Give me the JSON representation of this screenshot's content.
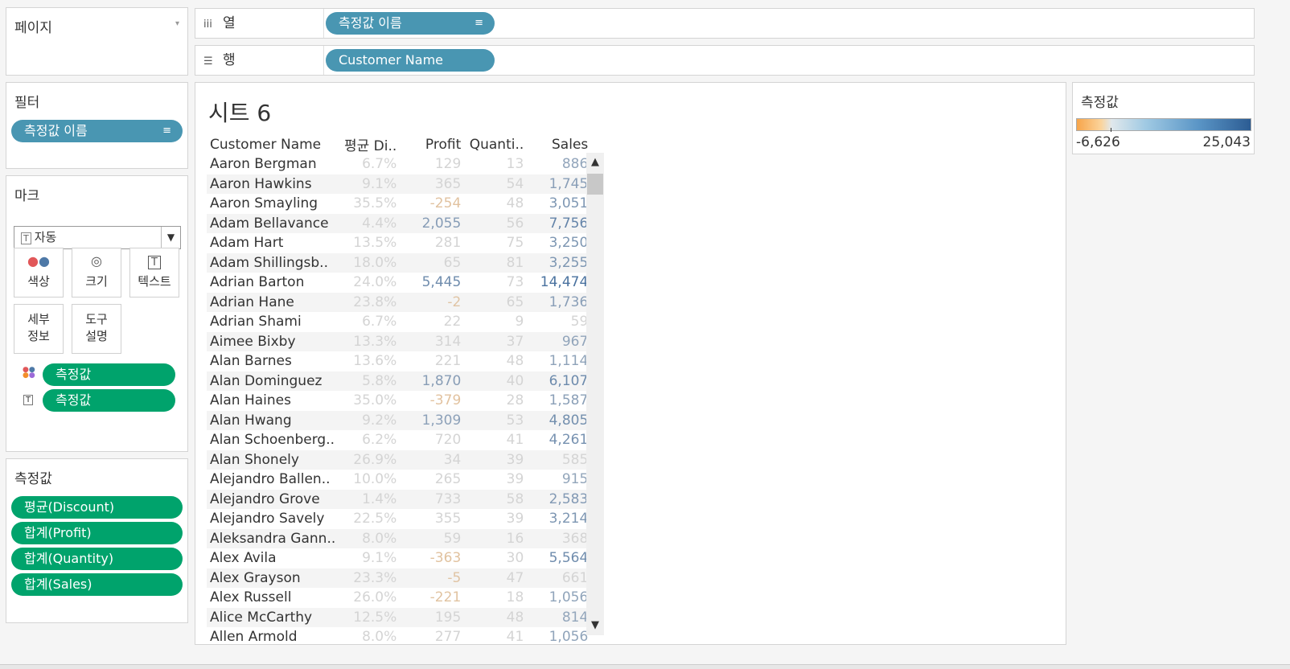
{
  "pages": {
    "title": "페이지"
  },
  "shelves": {
    "columns": {
      "label": "열",
      "pill": "측정값 이름"
    },
    "rows": {
      "label": "행",
      "pill": "Customer Name"
    }
  },
  "filters": {
    "title": "필터",
    "pill": "측정값 이름"
  },
  "marks": {
    "title": "마크",
    "type_dropdown": "자동",
    "buttons": {
      "color": "색상",
      "size": "크기",
      "text": "텍스트",
      "detail_line1": "세부",
      "detail_line2": "정보",
      "tooltip_line1": "도구",
      "tooltip_line2": "설명"
    },
    "fields": [
      "측정값",
      "측정값"
    ]
  },
  "measure_values": {
    "title": "측정값",
    "items": [
      "평균(Discount)",
      "합계(Profit)",
      "합계(Quantity)",
      "합계(Sales)"
    ]
  },
  "view": {
    "title": "시트 6",
    "headers": [
      "Customer Name",
      "평균 Di..",
      "Profit",
      "Quanti..",
      "Sales"
    ],
    "rows": [
      {
        "name": "Aaron Bergman",
        "discount": "6.7%",
        "profit": "129",
        "quantity": "13",
        "sales": "886"
      },
      {
        "name": "Aaron Hawkins",
        "discount": "9.1%",
        "profit": "365",
        "quantity": "54",
        "sales": "1,745"
      },
      {
        "name": "Aaron Smayling",
        "discount": "35.5%",
        "profit": "-254",
        "quantity": "48",
        "sales": "3,051"
      },
      {
        "name": "Adam Bellavance",
        "discount": "4.4%",
        "profit": "2,055",
        "quantity": "56",
        "sales": "7,756"
      },
      {
        "name": "Adam Hart",
        "discount": "13.5%",
        "profit": "281",
        "quantity": "75",
        "sales": "3,250"
      },
      {
        "name": "Adam Shillingsb..",
        "discount": "18.0%",
        "profit": "65",
        "quantity": "81",
        "sales": "3,255"
      },
      {
        "name": "Adrian Barton",
        "discount": "24.0%",
        "profit": "5,445",
        "quantity": "73",
        "sales": "14,474"
      },
      {
        "name": "Adrian Hane",
        "discount": "23.8%",
        "profit": "-2",
        "quantity": "65",
        "sales": "1,736"
      },
      {
        "name": "Adrian Shami",
        "discount": "6.7%",
        "profit": "22",
        "quantity": "9",
        "sales": "59"
      },
      {
        "name": "Aimee Bixby",
        "discount": "13.3%",
        "profit": "314",
        "quantity": "37",
        "sales": "967"
      },
      {
        "name": "Alan Barnes",
        "discount": "13.6%",
        "profit": "221",
        "quantity": "48",
        "sales": "1,114"
      },
      {
        "name": "Alan Dominguez",
        "discount": "5.8%",
        "profit": "1,870",
        "quantity": "40",
        "sales": "6,107"
      },
      {
        "name": "Alan Haines",
        "discount": "35.0%",
        "profit": "-379",
        "quantity": "28",
        "sales": "1,587"
      },
      {
        "name": "Alan Hwang",
        "discount": "9.2%",
        "profit": "1,309",
        "quantity": "53",
        "sales": "4,805"
      },
      {
        "name": "Alan Schoenberg..",
        "discount": "6.2%",
        "profit": "720",
        "quantity": "41",
        "sales": "4,261"
      },
      {
        "name": "Alan Shonely",
        "discount": "26.9%",
        "profit": "34",
        "quantity": "39",
        "sales": "585"
      },
      {
        "name": "Alejandro Ballen..",
        "discount": "10.0%",
        "profit": "265",
        "quantity": "39",
        "sales": "915"
      },
      {
        "name": "Alejandro Grove",
        "discount": "1.4%",
        "profit": "733",
        "quantity": "58",
        "sales": "2,583"
      },
      {
        "name": "Alejandro Savely",
        "discount": "22.5%",
        "profit": "355",
        "quantity": "39",
        "sales": "3,214"
      },
      {
        "name": "Aleksandra Gann..",
        "discount": "8.0%",
        "profit": "59",
        "quantity": "16",
        "sales": "368"
      },
      {
        "name": "Alex Avila",
        "discount": "9.1%",
        "profit": "-363",
        "quantity": "30",
        "sales": "5,564"
      },
      {
        "name": "Alex Grayson",
        "discount": "23.3%",
        "profit": "-5",
        "quantity": "47",
        "sales": "661"
      },
      {
        "name": "Alex Russell",
        "discount": "26.0%",
        "profit": "-221",
        "quantity": "18",
        "sales": "1,056"
      },
      {
        "name": "Alice McCarthy",
        "discount": "12.5%",
        "profit": "195",
        "quantity": "48",
        "sales": "814"
      },
      {
        "name": "Allen Armold",
        "discount": "8.0%",
        "profit": "277",
        "quantity": "41",
        "sales": "1,056"
      }
    ]
  },
  "legend": {
    "title": "측정값",
    "min": "-6,626",
    "max": "25,043",
    "min_value": -6626,
    "max_value": 25043
  },
  "colors": {
    "pill_blue": "#4996b2",
    "pill_green": "#00a36c",
    "negative": "#f7a54a",
    "positive": "#2c5c93",
    "neutral": "#d4d4d4"
  }
}
